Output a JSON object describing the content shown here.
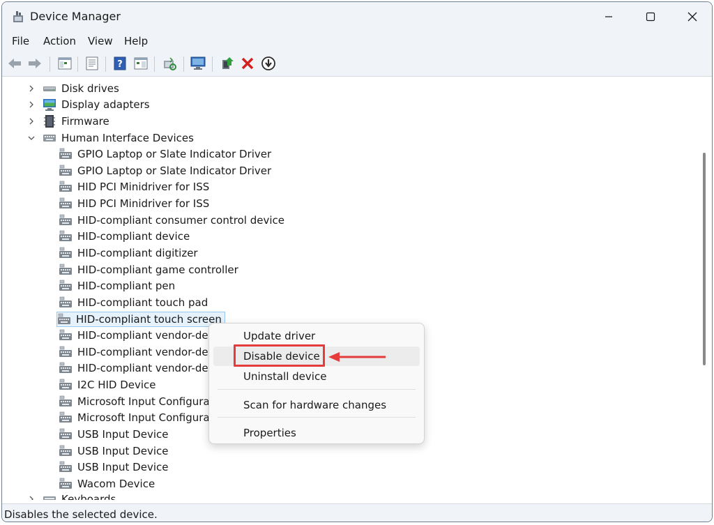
{
  "window": {
    "title": "Device Manager",
    "controls": {
      "minimize": "minimize",
      "maximize": "maximize",
      "close": "close"
    }
  },
  "menu": [
    "File",
    "Action",
    "View",
    "Help"
  ],
  "toolbar_icons": [
    "back-arrow-icon",
    "forward-arrow-icon",
    "show-hide-console-tree-icon",
    "properties-sheet-icon",
    "help-icon",
    "action-pane-icon",
    "scan-hardware-icon",
    "monitor-icon",
    "update-driver-icon",
    "uninstall-icon",
    "disable-device-icon"
  ],
  "tree": {
    "categories_before": [
      {
        "label": "Disk drives",
        "expanded": false,
        "icon": "disk-drive-icon"
      },
      {
        "label": "Display adapters",
        "expanded": false,
        "icon": "display-adapter-icon"
      },
      {
        "label": "Firmware",
        "expanded": false,
        "icon": "firmware-icon"
      }
    ],
    "expanded_category": {
      "label": "Human Interface Devices",
      "expanded": true,
      "icon": "hid-icon"
    },
    "children": [
      "GPIO Laptop or Slate Indicator Driver",
      "GPIO Laptop or Slate Indicator Driver",
      "HID PCI Minidriver for ISS",
      "HID PCI Minidriver for ISS",
      "HID-compliant consumer control device",
      "HID-compliant device",
      "HID-compliant digitizer",
      "HID-compliant game controller",
      "HID-compliant pen",
      "HID-compliant touch pad",
      "HID-compliant touch screen",
      "HID-compliant vendor-defi",
      "HID-compliant vendor-defi",
      "HID-compliant vendor-defi",
      "I2C HID Device",
      "Microsoft Input Configurati",
      "Microsoft Input Configurati",
      "USB Input Device",
      "USB Input Device",
      "USB Input Device",
      "Wacom Device"
    ],
    "selected_child": "HID-compliant touch screen",
    "categories_after": [
      {
        "label": "Keyboards",
        "expanded": false,
        "icon": "keyboard-icon"
      }
    ]
  },
  "context_menu": {
    "items": [
      "Update driver",
      "Disable device",
      "Uninstall device",
      "Scan for hardware changes",
      "Properties"
    ],
    "highlighted": "Disable device"
  },
  "status_bar": {
    "text": "Disables the selected device."
  },
  "colors": {
    "titlebar": "#f0f4f9",
    "selection": "#e5f1fb",
    "selection_border": "#99c9ef",
    "annotation_red": "#e53b3b"
  }
}
